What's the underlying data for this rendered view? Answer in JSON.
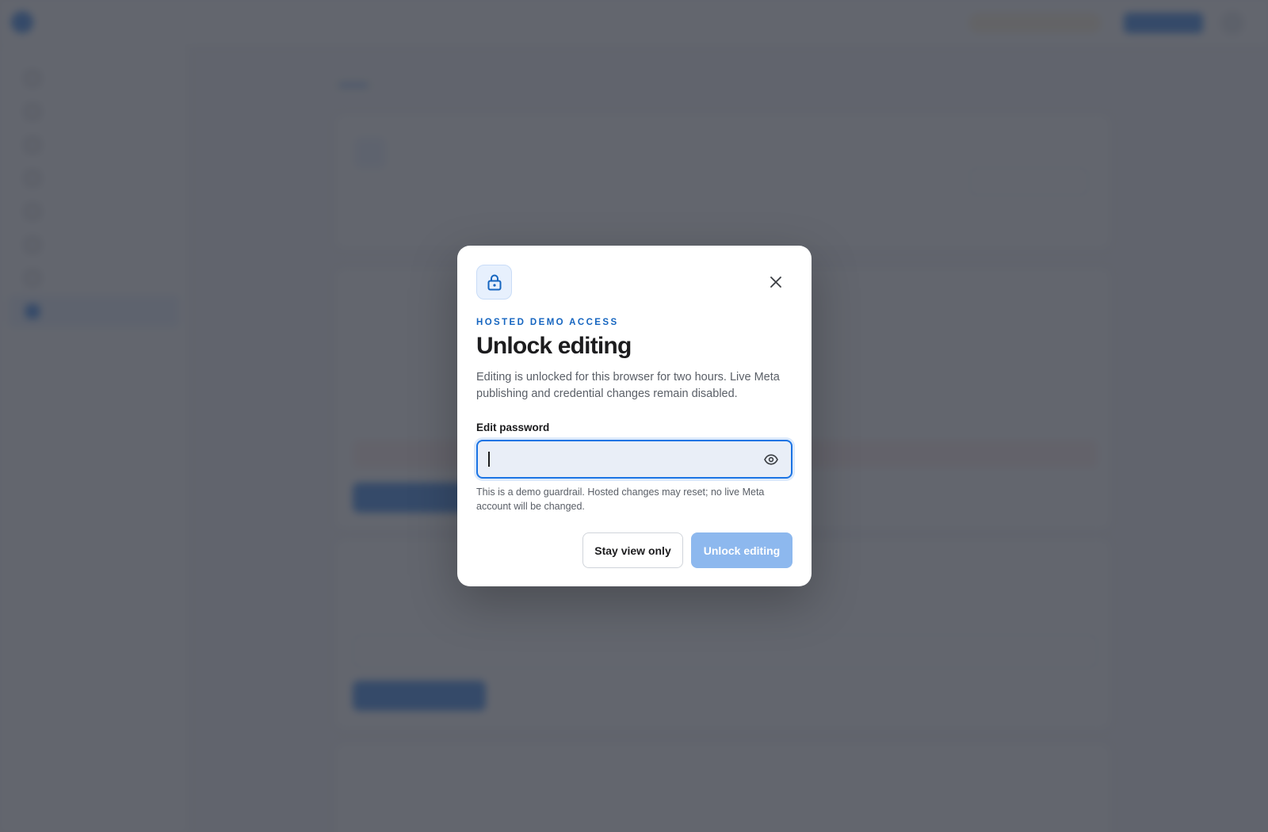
{
  "modal": {
    "eyebrow": "HOSTED DEMO ACCESS",
    "title": "Unlock editing",
    "description": "Editing is unlocked for this browser for two hours. Live Meta publishing and credential changes remain disabled.",
    "field_label": "Edit password",
    "password_value": "",
    "helper_text": "This is a demo guardrail. Hosted changes may reset; no live Meta account will be changed.",
    "secondary_button": "Stay view only",
    "primary_button": "Unlock editing",
    "primary_disabled": true,
    "icons": {
      "lock": "lock-icon",
      "close": "close-icon",
      "visibility": "eye-icon"
    }
  },
  "colors": {
    "accent": "#1b74e4",
    "eyebrow": "#1565c0",
    "primary_disabled_bg": "#8db8ee",
    "overlay": "rgba(60, 64, 74, 0.80)"
  }
}
